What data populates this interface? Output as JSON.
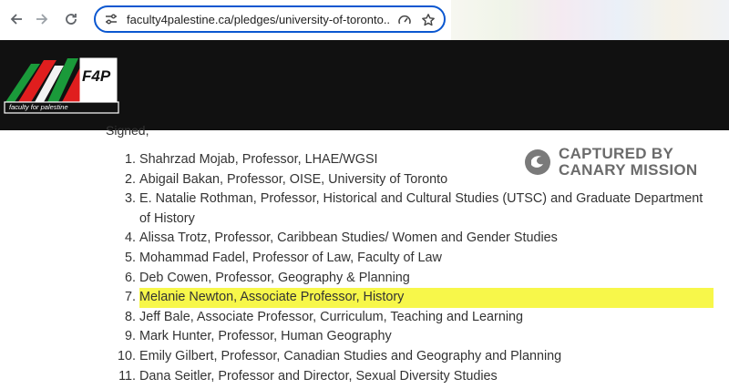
{
  "browser": {
    "url": "faculty4palestine.ca/pledges/university-of-toronto...",
    "back_icon": "arrow-left-icon",
    "forward_icon": "arrow-right-icon",
    "reload_icon": "reload-icon",
    "site_icon": "site-settings-icon",
    "speed_icon": "gauge-icon",
    "bookmark_icon": "star-icon"
  },
  "logo": {
    "text": "F4P",
    "tagline": "faculty for palestine"
  },
  "content": {
    "signed_label": "Signed,",
    "signatories": [
      "Shahrzad Mojab, Professor, LHAE/WGSI",
      "Abigail Bakan, Professor, OISE, University of Toronto",
      "E. Natalie Rothman, Professor, Historical and Cultural Studies (UTSC) and Graduate Department of History",
      "Alissa Trotz, Professor, Caribbean Studies/ Women and Gender Studies",
      "Mohammad Fadel, Professor of Law, Faculty of Law",
      "Deb Cowen, Professor, Geography & Planning",
      "Melanie Newton, Associate Professor, History",
      "Jeff Bale, Associate Professor, Curriculum, Teaching and Learning",
      "Mark Hunter, Professor, Human Geography",
      "Emily Gilbert, Professor, Canadian Studies and Geography and Planning",
      "Dana Seitler, Professor and Director, Sexual Diversity Studies"
    ]
  },
  "watermark": {
    "line1": "CAPTURED BY",
    "line2": "CANARY MISSION"
  },
  "colors": {
    "url_border": "#0b57d0",
    "header_bg": "#111111",
    "highlight": "#f7f74a"
  }
}
